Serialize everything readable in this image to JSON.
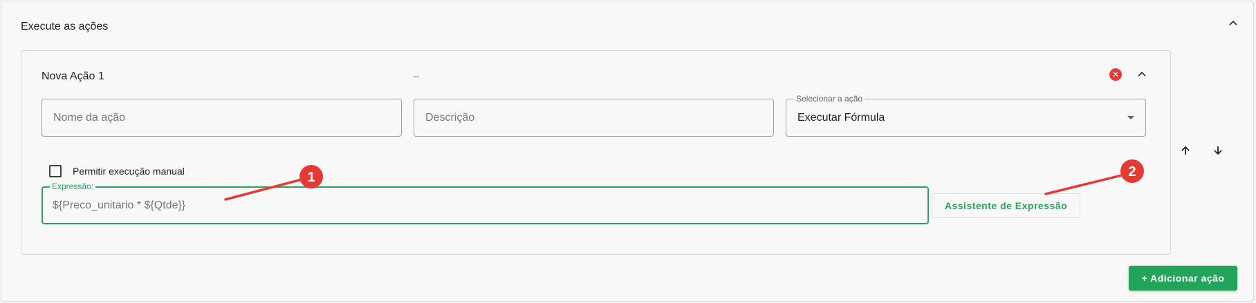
{
  "section": {
    "title": "Execute as ações"
  },
  "action": {
    "title": "Nova Ação 1",
    "description": "--",
    "name_placeholder": "Nome da ação",
    "description_placeholder": "Descrição",
    "select_label": "Selecionar a ação",
    "select_value": "Executar Fórmula",
    "manual_label": "Permitir execução manual",
    "manual_checked": false,
    "expression_label": "Expressão:",
    "expression_value": "${Preco_unitario * ${Qtde}}",
    "assistant_button": "Assistente de Expressão"
  },
  "add_button": "+ Adicionar ação",
  "annotations": {
    "marker_1": "1",
    "marker_2": "2",
    "color": "#e53935"
  },
  "colors": {
    "accent": "#27a35a",
    "primary_button": "#22a45a",
    "danger": "#e53935"
  },
  "icons": [
    "chevron-up-icon",
    "remove-circle-icon",
    "arrow-up-icon",
    "arrow-down-icon"
  ]
}
